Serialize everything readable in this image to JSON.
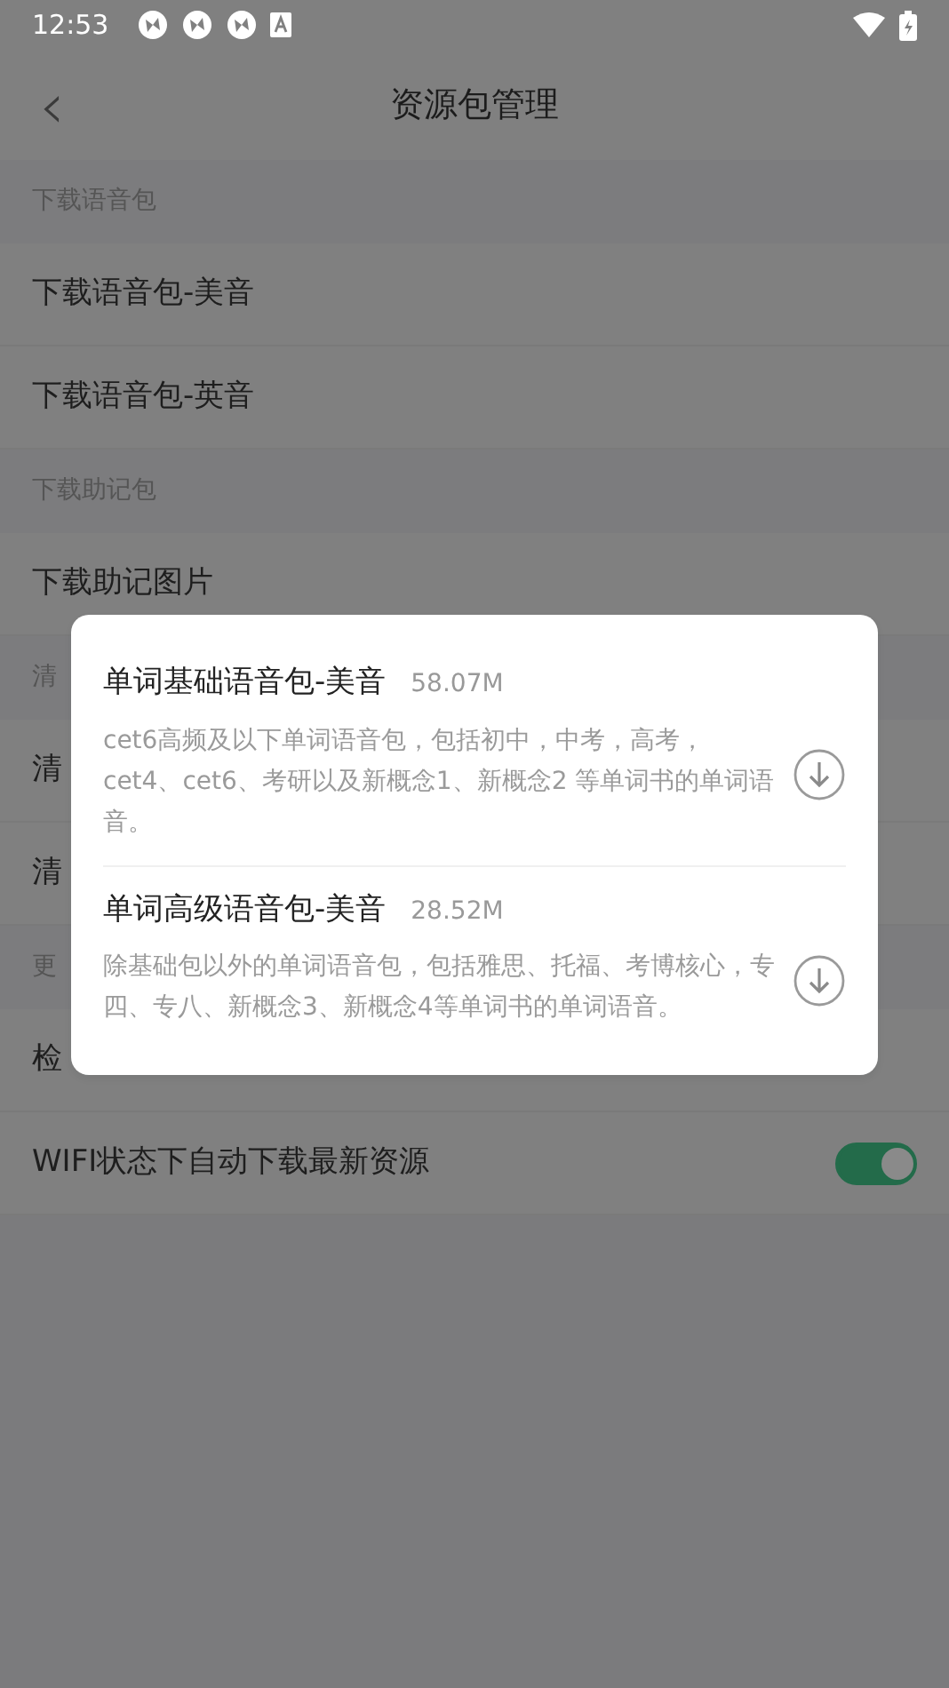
{
  "status_bar": {
    "time": "12:53"
  },
  "header": {
    "back": "‹",
    "title": "资源包管理"
  },
  "rows": [
    {
      "kind": "section",
      "label": "下载语音包"
    },
    {
      "kind": "item",
      "label": "下载语音包-美音"
    },
    {
      "kind": "item",
      "label": "下载语音包-英音"
    },
    {
      "kind": "section",
      "label": "下载助记包"
    },
    {
      "kind": "item",
      "label": "下载助记图片"
    },
    {
      "kind": "section",
      "label": "清"
    },
    {
      "kind": "item",
      "label": "清"
    },
    {
      "kind": "item",
      "label": "清"
    },
    {
      "kind": "section",
      "label": "更"
    },
    {
      "kind": "item",
      "label": "检"
    },
    {
      "kind": "toggle",
      "label": "WIFI状态下自动下载最新资源",
      "on": true
    }
  ],
  "dialog": {
    "packages": [
      {
        "title": "单词基础语音包-美音",
        "size": "58.07M",
        "description": "cet6高频及以下单词语音包，包括初中，中考，高考，cet4、cet6、考研以及新概念1、新概念2 等单词书的单词语音。"
      },
      {
        "title": "单词高级语音包-美音",
        "size": "28.52M",
        "description": "除基础包以外的单词语音包，包括雅思、托福、考博核心，专四、专八、新概念3、新概念4等单词书的单词语音。"
      }
    ]
  }
}
